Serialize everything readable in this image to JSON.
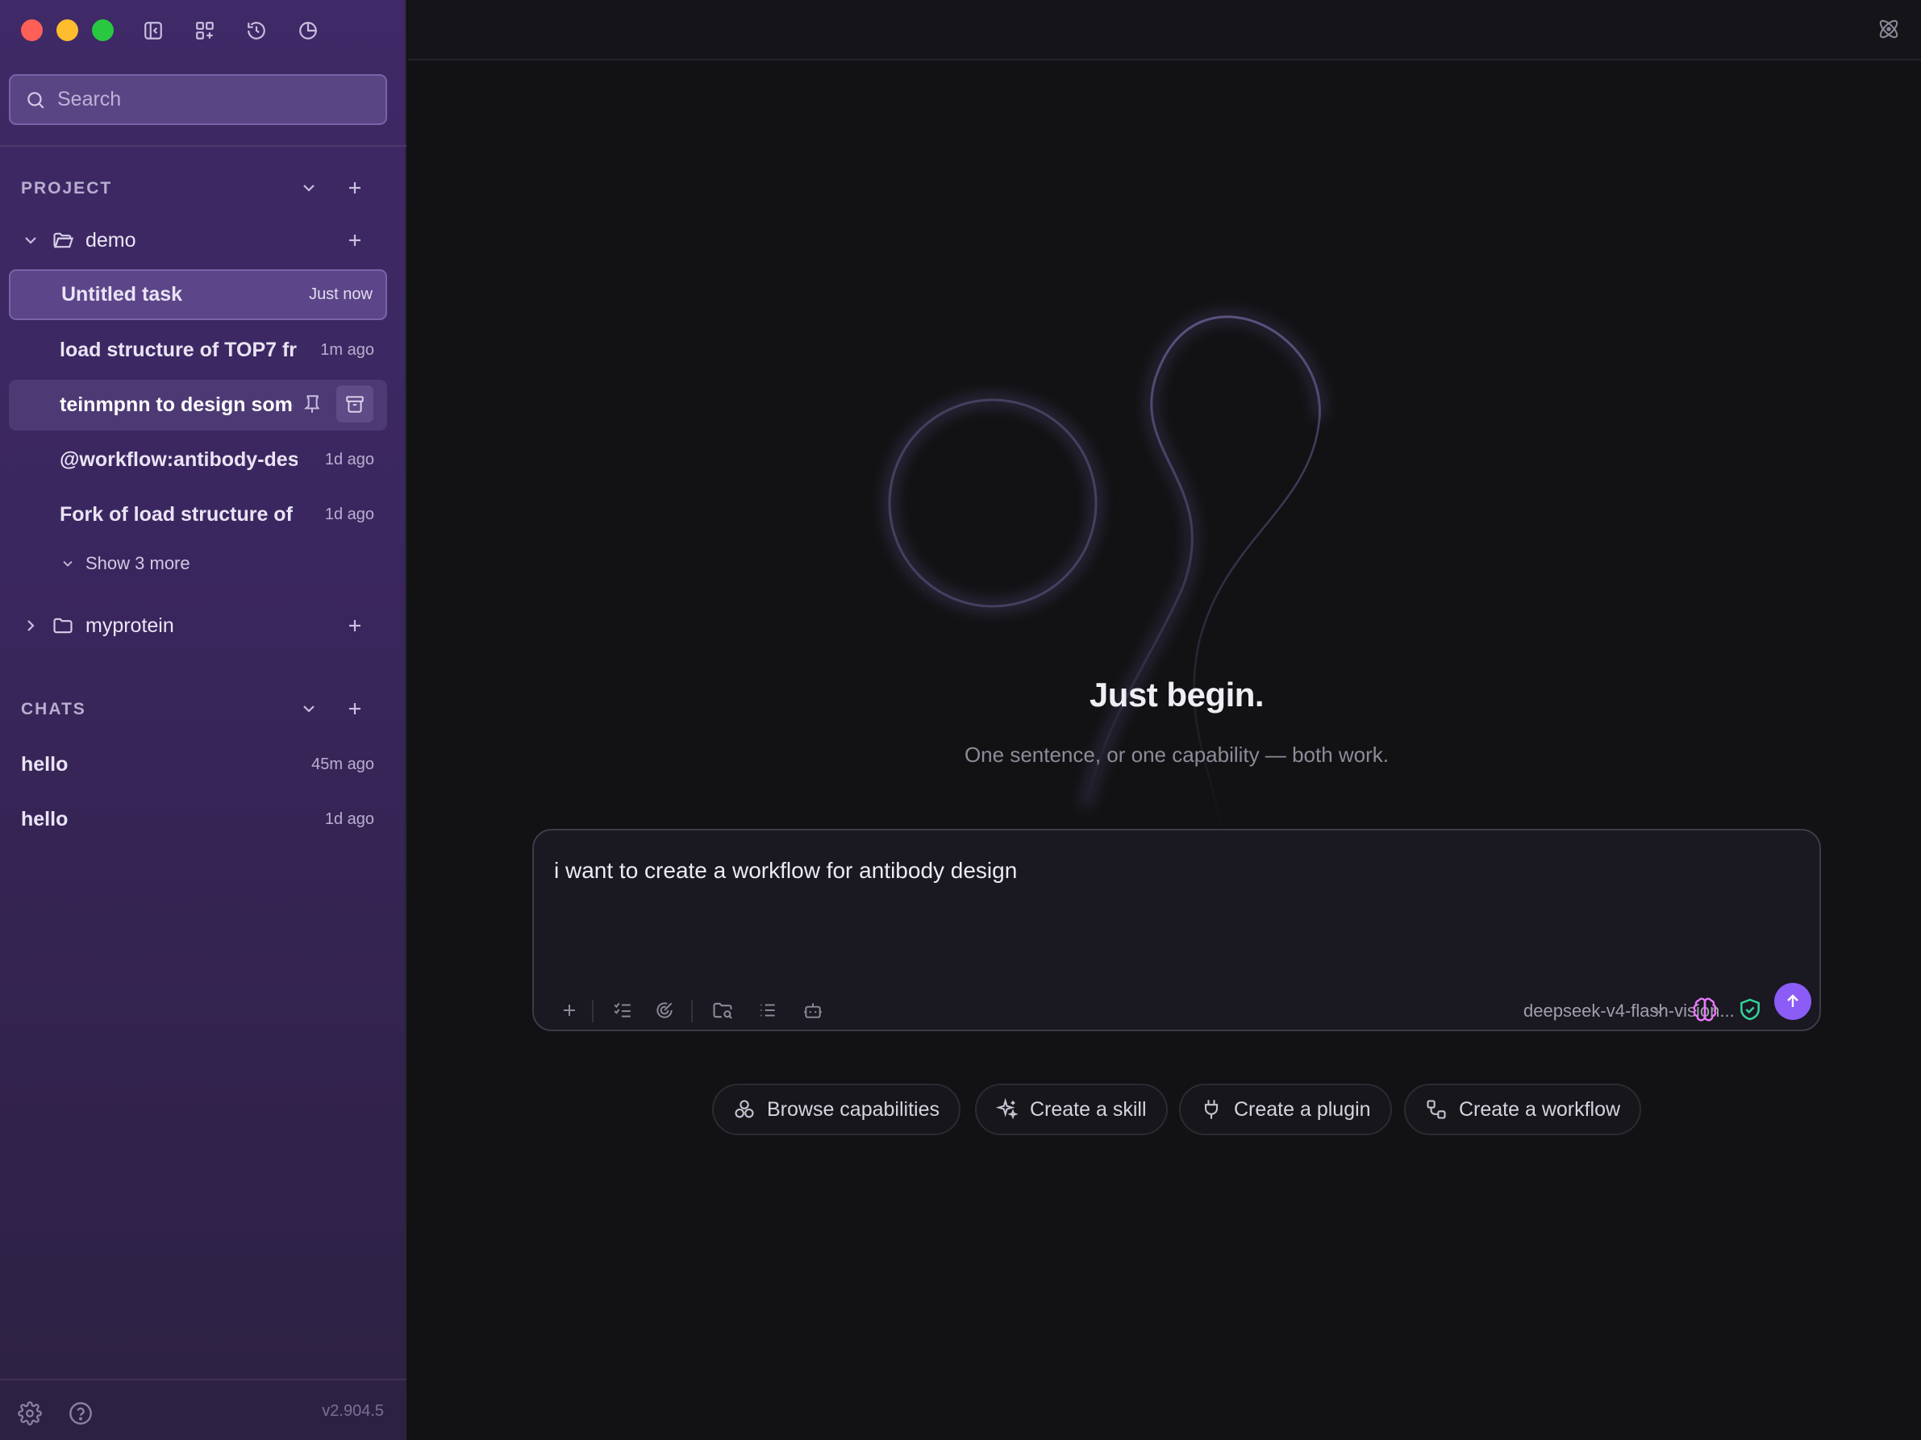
{
  "sidebar": {
    "search_placeholder": "Search",
    "project_header": "PROJECT",
    "folders": [
      {
        "name": "demo",
        "expanded": true,
        "tasks": [
          {
            "title": "Untitled task",
            "time": "Just now"
          },
          {
            "title": "load structure of TOP7 fr",
            "time": "1m ago"
          },
          {
            "title": "teinmpnn to design some",
            "time": ""
          },
          {
            "title": "@workflow:antibody-des",
            "time": "1d ago"
          },
          {
            "title": "Fork of load structure of",
            "time": "1d ago"
          }
        ],
        "show_more": "Show 3 more"
      },
      {
        "name": "myprotein",
        "expanded": false
      }
    ],
    "chats_header": "CHATS",
    "chats": [
      {
        "title": "hello",
        "time": "45m ago"
      },
      {
        "title": "hello",
        "time": "1d ago"
      }
    ],
    "version": "v2.904.5"
  },
  "main": {
    "hero_title": "Just begin.",
    "hero_subtitle": "One sentence, or one capability — both work.",
    "composer": {
      "text": "i want to create a workflow for antibody design",
      "model": "deepseek-v4-flash-vision..."
    },
    "actions": [
      {
        "label": "Browse capabilities",
        "icon": "capabilities-icon"
      },
      {
        "label": "Create a skill",
        "icon": "sparkle-icon"
      },
      {
        "label": "Create a plugin",
        "icon": "plug-icon"
      },
      {
        "label": "Create a workflow",
        "icon": "workflow-icon"
      }
    ]
  },
  "colors": {
    "accent": "#8b5cf6",
    "sidebar_bg": "#3f2966",
    "selected_row": "#5c4589",
    "main_bg": "#121214",
    "traffic_red": "#fe5f57",
    "traffic_yellow": "#febc2e",
    "traffic_green": "#28c840",
    "shield_green": "#34d399",
    "brain_pink": "#e879f9"
  }
}
